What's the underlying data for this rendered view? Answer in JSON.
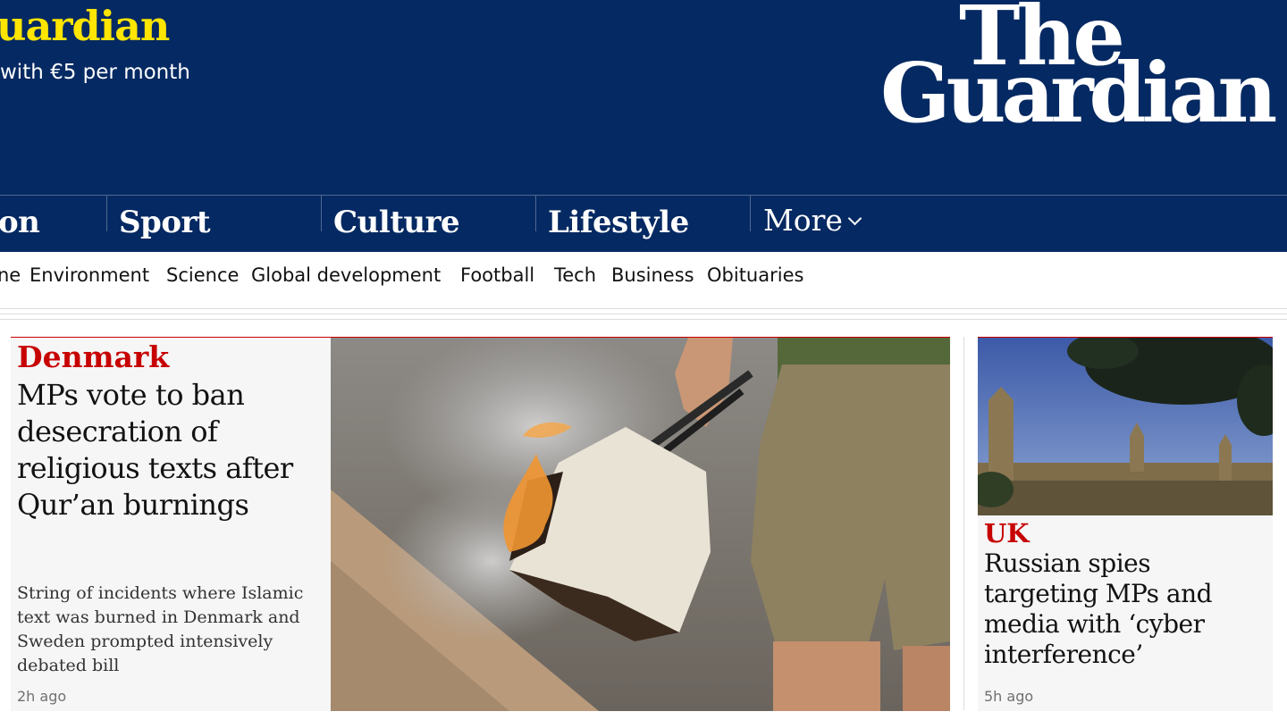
{
  "masthead": {
    "support_title": "uardian",
    "support_subtitle": "with €5 per month",
    "logo_line1": "The",
    "logo_line2": "Guardian"
  },
  "nav": {
    "pillars": [
      "on",
      "Sport",
      "Culture",
      "Lifestyle"
    ],
    "more_label": "More"
  },
  "subnav": {
    "items": [
      "ne",
      "Environment",
      "Science",
      "Global development",
      "Football",
      "Tech",
      "Business",
      "Obituaries"
    ]
  },
  "main_story": {
    "kicker": "Denmark",
    "headline": "MPs vote to ban desecration of religious texts after Qur’an burnings",
    "standfirst": "String of incidents where Islamic text was burned in Denmark and Sweden prompted intensively debated bill",
    "age": "2h ago"
  },
  "side_story": {
    "kicker": "UK",
    "headline": "Russian spies targeting MPs and media with ‘cyber interference’",
    "age": "5h ago"
  },
  "colors": {
    "brand_blue": "#052962",
    "support_yellow": "#ffe500",
    "news_red": "#c70000",
    "card_bg": "#f6f6f6"
  }
}
